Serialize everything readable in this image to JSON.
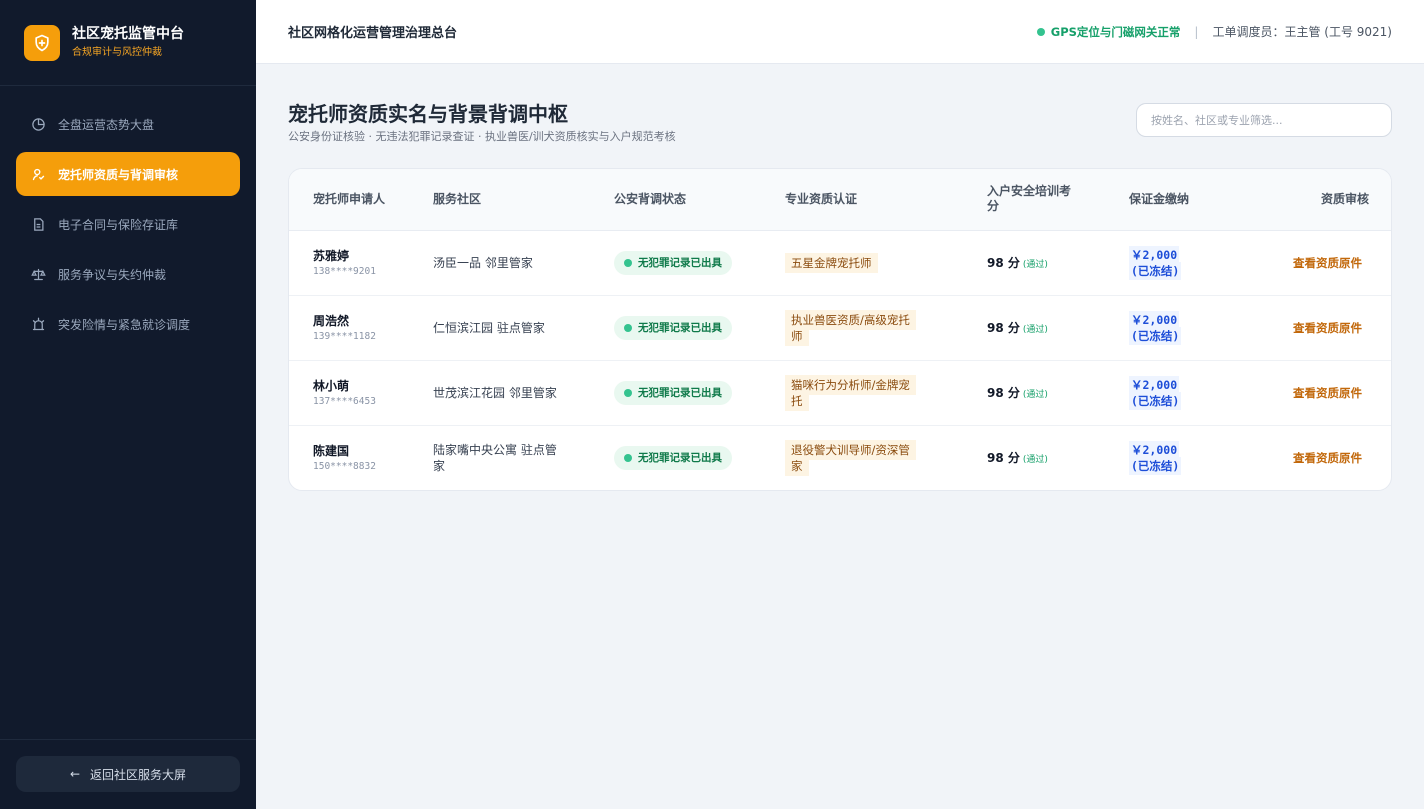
{
  "sidebar": {
    "brand_title": "社区宠托监管中台",
    "brand_subtitle": "合规审计与风控仲裁",
    "items": [
      {
        "label": "全盘运营态势大盘",
        "icon": "pie-chart-icon",
        "active": false
      },
      {
        "label": "宠托师资质与背调审核",
        "icon": "user-check-icon",
        "active": true
      },
      {
        "label": "电子合同与保险存证库",
        "icon": "contract-icon",
        "active": false
      },
      {
        "label": "服务争议与失约仲裁",
        "icon": "scale-icon",
        "active": false
      },
      {
        "label": "突发险情与紧急就诊调度",
        "icon": "alarm-icon",
        "active": false
      }
    ],
    "back_label": "返回社区服务大屏"
  },
  "header": {
    "title": "社区网格化运营管理治理总台",
    "status": "GPS定位与门磁网关正常",
    "separator": "|",
    "operator": "工单调度员：王主管 (工号 9021)"
  },
  "page": {
    "title": "宠托师资质实名与背景背调中枢",
    "subtitle": "公安身份证核验 · 无违法犯罪记录查证 · 执业兽医/训犬资质核实与入户规范考核",
    "search_placeholder": "按姓名、社区或专业筛选..."
  },
  "table": {
    "columns": [
      "宠托师申请人",
      "服务社区",
      "公安背调状态",
      "专业资质认证",
      "入户安全培训考分",
      "保证金缴纳",
      "资质审核"
    ],
    "rows": [
      {
        "name": "苏雅婷",
        "phone": "138****9201",
        "community": "汤臣一品 邻里管家",
        "check": "无犯罪记录已出具",
        "qualification": "五星金牌宠托师",
        "score": "98 分",
        "score_status": "(通过)",
        "deposit": "￥2,000 (已冻结)",
        "action": "查看资质原件"
      },
      {
        "name": "周浩然",
        "phone": "139****1182",
        "community": "仁恒滨江园 驻点管家",
        "check": "无犯罪记录已出具",
        "qualification": "执业兽医资质/高级宠托师",
        "score": "98 分",
        "score_status": "(通过)",
        "deposit": "￥2,000 (已冻结)",
        "action": "查看资质原件"
      },
      {
        "name": "林小萌",
        "phone": "137****6453",
        "community": "世茂滨江花园 邻里管家",
        "check": "无犯罪记录已出具",
        "qualification": "猫咪行为分析师/金牌宠托",
        "score": "98 分",
        "score_status": "(通过)",
        "deposit": "￥2,000 (已冻结)",
        "action": "查看资质原件"
      },
      {
        "name": "陈建国",
        "phone": "150****8832",
        "community": "陆家嘴中央公寓 驻点管家",
        "check": "无犯罪记录已出具",
        "qualification": "退役警犬训导师/资深管家",
        "score": "98 分",
        "score_status": "(通过)",
        "deposit": "￥2,000 (已冻结)",
        "action": "查看资质原件"
      }
    ]
  },
  "colors": {
    "sidebar_bg": "#111a2c",
    "accent": "#f59e0b",
    "success": "#34c38f",
    "deposit_blue": "#1d4ed8",
    "action_orange": "#c2680b"
  }
}
